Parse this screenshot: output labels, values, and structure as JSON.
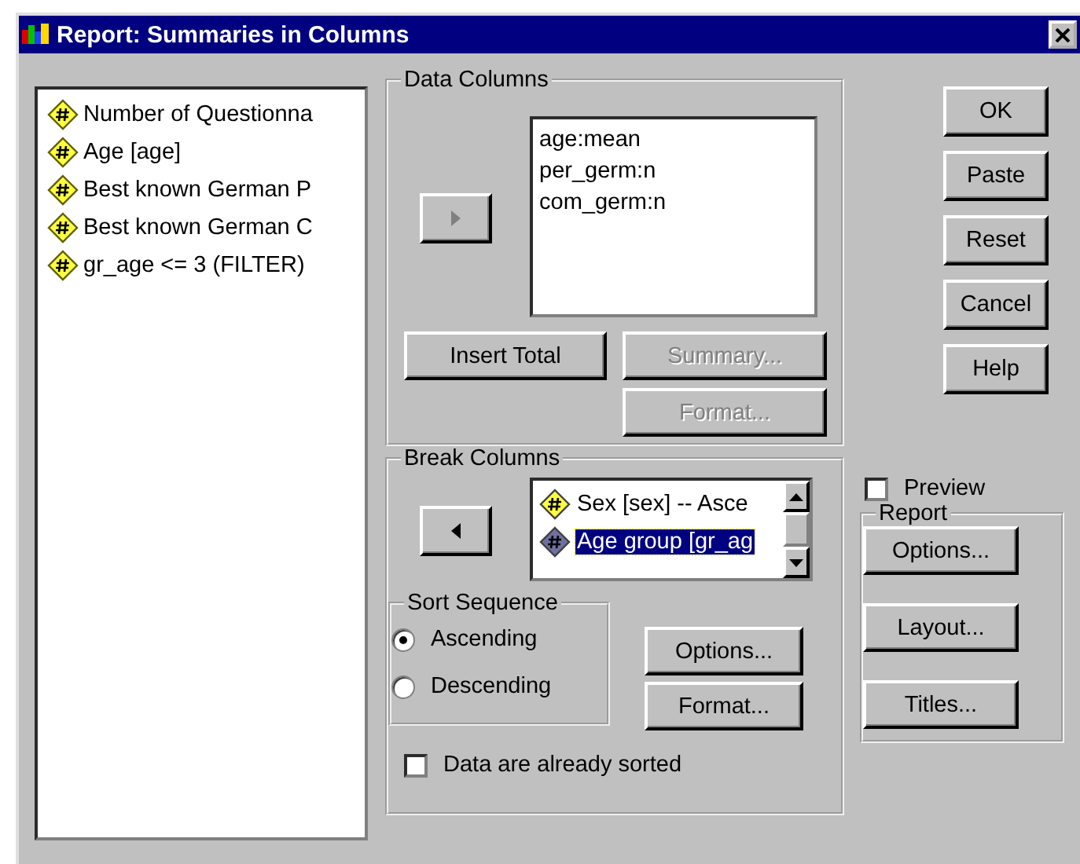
{
  "window": {
    "title": "Report: Summaries in Columns"
  },
  "variables": [
    {
      "label": "Number of Questionna"
    },
    {
      "label": "Age [age]"
    },
    {
      "label": "Best known German P"
    },
    {
      "label": "Best known German C"
    },
    {
      "label": "gr_age <= 3 (FILTER)"
    }
  ],
  "data_columns": {
    "legend": "Data Columns",
    "items": [
      "age:mean",
      "per_germ:n",
      "com_germ:n"
    ],
    "buttons": [
      {
        "label": "Insert Total",
        "disabled": false
      },
      {
        "label": "Summary...",
        "disabled": true
      },
      {
        "label": "Format...",
        "disabled": true
      }
    ]
  },
  "break_columns": {
    "legend": "Break Columns",
    "items": [
      {
        "label": "Sex [sex] -- Asce",
        "selected": false
      },
      {
        "label": "Age group [gr_ag",
        "selected": true
      }
    ],
    "sort_sequence": {
      "legend": "Sort Sequence",
      "options": [
        {
          "label": "Ascending",
          "selected": true
        },
        {
          "label": "Descending",
          "selected": false
        }
      ]
    },
    "buttons": [
      {
        "label": "Options...",
        "disabled": false
      },
      {
        "label": "Format...",
        "disabled": false
      }
    ],
    "already_sorted": {
      "label": "Data are already sorted",
      "checked": false
    }
  },
  "dialog_buttons": [
    "OK",
    "Paste",
    "Reset",
    "Cancel",
    "Help"
  ],
  "preview": {
    "label": "Preview",
    "checked": false
  },
  "report": {
    "legend": "Report",
    "buttons": [
      "Options...",
      "Layout...",
      "Titles..."
    ]
  }
}
